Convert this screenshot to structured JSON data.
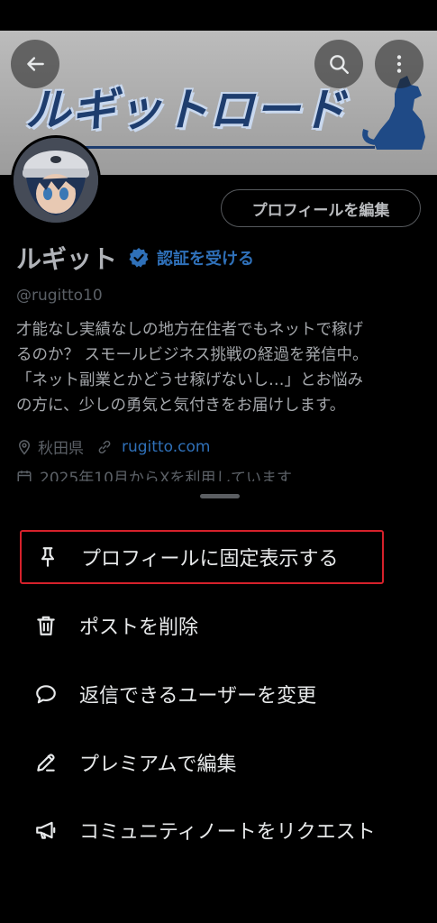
{
  "header": {
    "banner_title": "ルギットロード",
    "back_icon": "arrow-left-icon",
    "search_icon": "search-icon",
    "more_icon": "more-vertical-icon"
  },
  "profile": {
    "edit_label": "プロフィールを編集",
    "name": "ルギット",
    "verify_label": "認証を受ける",
    "handle": "@rugitto10",
    "bio": [
      "才能なし実績なしの地方在住者でもネットで稼げ",
      "るのか？ スモールビジネス挑戦の経過を発信中。",
      "「ネット副業とかどうせ稼げないし…」とお悩み",
      "の方に、少しの勇気と気付きをお届けします。"
    ],
    "location": "秋田県",
    "website": "rugitto.com",
    "joined": "2025年10月からXを利用しています"
  },
  "menu": {
    "items": [
      {
        "label": "プロフィールに固定表示する",
        "icon": "pin-icon"
      },
      {
        "label": "ポストを削除",
        "icon": "trash-icon"
      },
      {
        "label": "返信できるユーザーを変更",
        "icon": "reply-bubble-icon"
      },
      {
        "label": "プレミアムで編集",
        "icon": "pencil-icon"
      },
      {
        "label": "コミュニティノートをリクエスト",
        "icon": "megaphone-icon"
      }
    ]
  },
  "colors": {
    "accent_link": "#2f70b8",
    "highlight_border": "#d6212b",
    "background": "#000000"
  }
}
